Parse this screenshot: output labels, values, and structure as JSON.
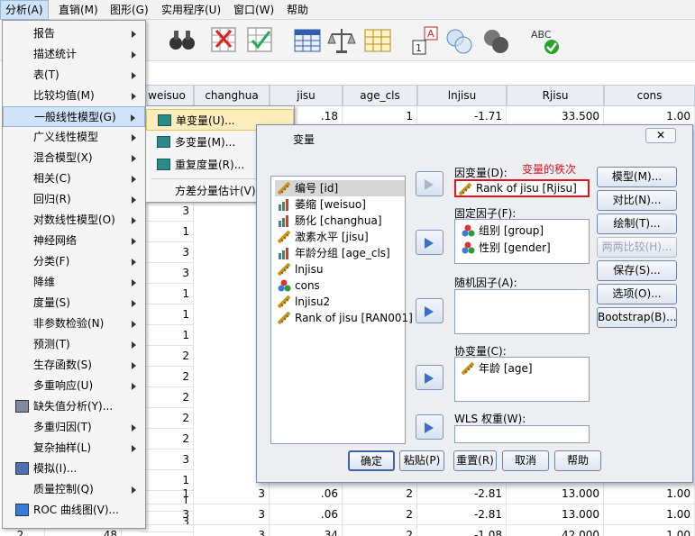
{
  "menubar": {
    "items": [
      "分析(A)",
      "直销(M)",
      "图形(G)",
      "实用程序(U)",
      "窗口(W)",
      "帮助"
    ]
  },
  "analyze_menu": {
    "items": [
      {
        "label": "报告",
        "arrow": true
      },
      {
        "label": "描述统计",
        "arrow": true
      },
      {
        "label": "表(T)",
        "arrow": true
      },
      {
        "label": "比较均值(M)",
        "arrow": true
      },
      {
        "label": "一般线性模型(G)",
        "arrow": true
      },
      {
        "label": "广义线性模型",
        "arrow": true
      },
      {
        "label": "混合模型(X)",
        "arrow": true
      },
      {
        "label": "相关(C)",
        "arrow": true
      },
      {
        "label": "回归(R)",
        "arrow": true
      },
      {
        "label": "对数线性模型(O)",
        "arrow": true
      },
      {
        "label": "神经网络",
        "arrow": true
      },
      {
        "label": "分类(F)",
        "arrow": true
      },
      {
        "label": "降维",
        "arrow": true
      },
      {
        "label": "度量(S)",
        "arrow": true
      },
      {
        "label": "非参数检验(N)",
        "arrow": true
      },
      {
        "label": "预测(T)",
        "arrow": true
      },
      {
        "label": "生存函数(S)",
        "arrow": true
      },
      {
        "label": "多重响应(U)",
        "arrow": true
      },
      {
        "label": "缺失值分析(Y)...",
        "arrow": false
      },
      {
        "label": "多重归因(T)",
        "arrow": true
      },
      {
        "label": "复杂抽样(L)",
        "arrow": true
      },
      {
        "label": "模拟(I)...",
        "arrow": false
      },
      {
        "label": "质量控制(Q)",
        "arrow": true
      },
      {
        "label": "ROC 曲线图(V)...",
        "arrow": false
      }
    ]
  },
  "glm_submenu": {
    "items": [
      "单变量(U)...",
      "多变量(M)...",
      "重复度量(R)...",
      "方差分量估计(V)..."
    ]
  },
  "grid": {
    "headers": [
      "weisuo",
      "changhua",
      "jisu",
      "age_cls",
      "lnjisu",
      "Rjisu",
      "cons"
    ],
    "first_row": [
      "",
      "",
      ".18",
      "1",
      "-1.71",
      "33.500",
      "1.00"
    ],
    "weisuo_col": [
      "3",
      "1",
      "3",
      "3",
      "1",
      "1",
      "1",
      "2",
      "2",
      "2",
      "2",
      "2",
      "3",
      "1",
      "1",
      "3",
      "2"
    ],
    "bottom_rows": [
      [
        "1",
        "3",
        ".06",
        "2",
        "-2.81",
        "13.000",
        "1.00"
      ],
      [
        "3",
        "3",
        ".06",
        "2",
        "-2.81",
        "13.000",
        "1.00"
      ],
      [
        "2",
        "48",
        "3",
        ".34",
        "2",
        "-1.08",
        "42.000",
        "1.00"
      ]
    ]
  },
  "dialog": {
    "title": "变量",
    "annotation": "变量的秩次",
    "source_vars": [
      {
        "label": "编号 [id]",
        "icon": "ruler-icon"
      },
      {
        "label": "萎缩 [weisuo]",
        "icon": "bar-icon"
      },
      {
        "label": "肠化 [changhua]",
        "icon": "bar-icon"
      },
      {
        "label": "激素水平 [jisu]",
        "icon": "ruler-icon"
      },
      {
        "label": "年龄分组 [age_cls]",
        "icon": "bar-icon"
      },
      {
        "label": "lnjisu",
        "icon": "ruler-icon"
      },
      {
        "label": "cons",
        "icon": "nominal-icon"
      },
      {
        "label": "lnjisu2",
        "icon": "ruler-icon"
      },
      {
        "label": "Rank of jisu [RAN001]",
        "icon": "ruler-icon"
      }
    ],
    "dependent_label": "因变量(D):",
    "dependent_value": "Rank of jisu [Rjisu]",
    "fixed_label": "固定因子(F):",
    "fixed_items": [
      "组别 [group]",
      "性别 [gender]"
    ],
    "random_label": "随机因子(A):",
    "covariate_label": "协变量(C):",
    "covariate_items": [
      "年龄 [age]"
    ],
    "wls_label": "WLS 权重(W):",
    "side_buttons": [
      "模型(M)...",
      "对比(N)...",
      "绘制(T)...",
      "两两比较(H)...",
      "保存(S)...",
      "选项(O)...",
      "Bootstrap(B)..."
    ],
    "bottom_buttons": [
      "确定",
      "粘贴(P)",
      "重置(R)",
      "取消",
      "帮助"
    ]
  },
  "colors": {
    "accent": "#3a6fc4",
    "annotation": "#e0141e",
    "highlight": "#cfe4f9"
  }
}
